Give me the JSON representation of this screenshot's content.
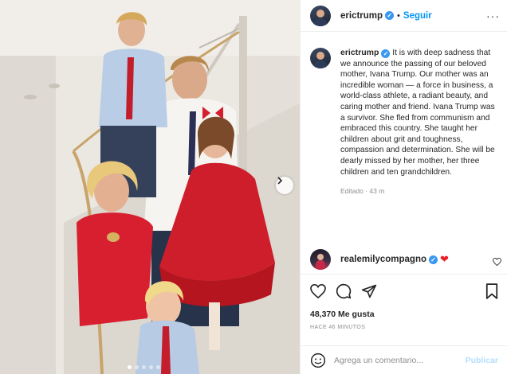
{
  "photo": {
    "description_icon": "family-portrait-photo",
    "carousel_dots": 5,
    "active_dot": 0
  },
  "header": {
    "username": "erictrump",
    "separator": "•",
    "follow_label": "Seguir",
    "more_icon": "more-horizontal-icon"
  },
  "caption": {
    "username": "erictrump",
    "text": "It is with deep sadness that we announce the passing of our beloved mother, Ivana Trump. Our mother was an incredible woman — a force in business, a world-class athlete, a radiant beauty, and caring mother and friend. Ivana Trump was a survivor. She fled from communism and embraced this country. She taught her children about grit and toughness, compassion and determination. She will be dearly missed by her mother, her three children and ten grandchildren.",
    "edited": "Editado · 43 m"
  },
  "comment": {
    "username": "realemilycompagno",
    "text": "❤"
  },
  "actions": {
    "likes": "48,370 Me gusta",
    "time": "HACE 46 MINUTOS"
  },
  "add_comment": {
    "placeholder": "Agrega un comentario...",
    "post_label": "Publicar"
  },
  "colors": {
    "accent": "#0095f6",
    "verified": "#3897f0",
    "muted": "#8e8e8e"
  }
}
